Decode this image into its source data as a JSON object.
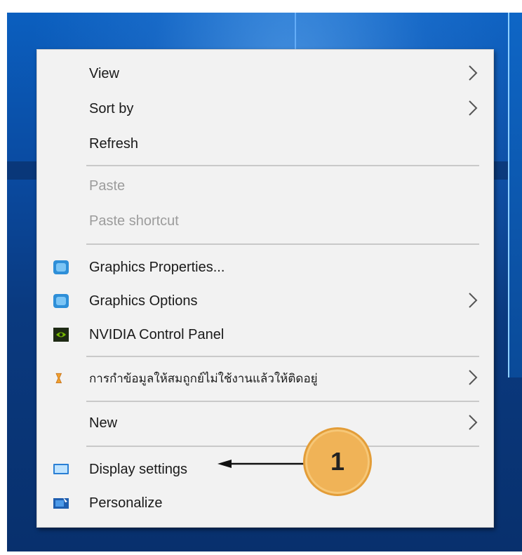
{
  "menu": {
    "items": [
      {
        "label": "View",
        "submenu": true
      },
      {
        "label": "Sort by",
        "submenu": true
      },
      {
        "label": "Refresh",
        "submenu": false
      },
      {
        "label": "Paste",
        "disabled": true
      },
      {
        "label": "Paste shortcut",
        "disabled": true
      },
      {
        "label": "Graphics Properties...",
        "icon": "intel-graphics-icon"
      },
      {
        "label": "Graphics Options",
        "icon": "intel-graphics-icon",
        "submenu": true
      },
      {
        "label": "NVIDIA Control Panel",
        "icon": "nvidia-icon"
      },
      {
        "label": "การกำข้อมูลให้สมถูกย์ไม่ใช้งานแล้วให้ติดอยู่",
        "icon": "hourglass-icon",
        "submenu": true
      },
      {
        "label": "New",
        "submenu": true
      },
      {
        "label": "Display settings",
        "icon": "display-settings-icon"
      },
      {
        "label": "Personalize",
        "icon": "personalize-icon"
      }
    ]
  },
  "callout": {
    "number": "1",
    "color": "#f0b357"
  },
  "colors": {
    "menu_bg": "#f2f2f2",
    "desktop": "#0a4aa0",
    "disabled_text": "#9c9c9c"
  }
}
